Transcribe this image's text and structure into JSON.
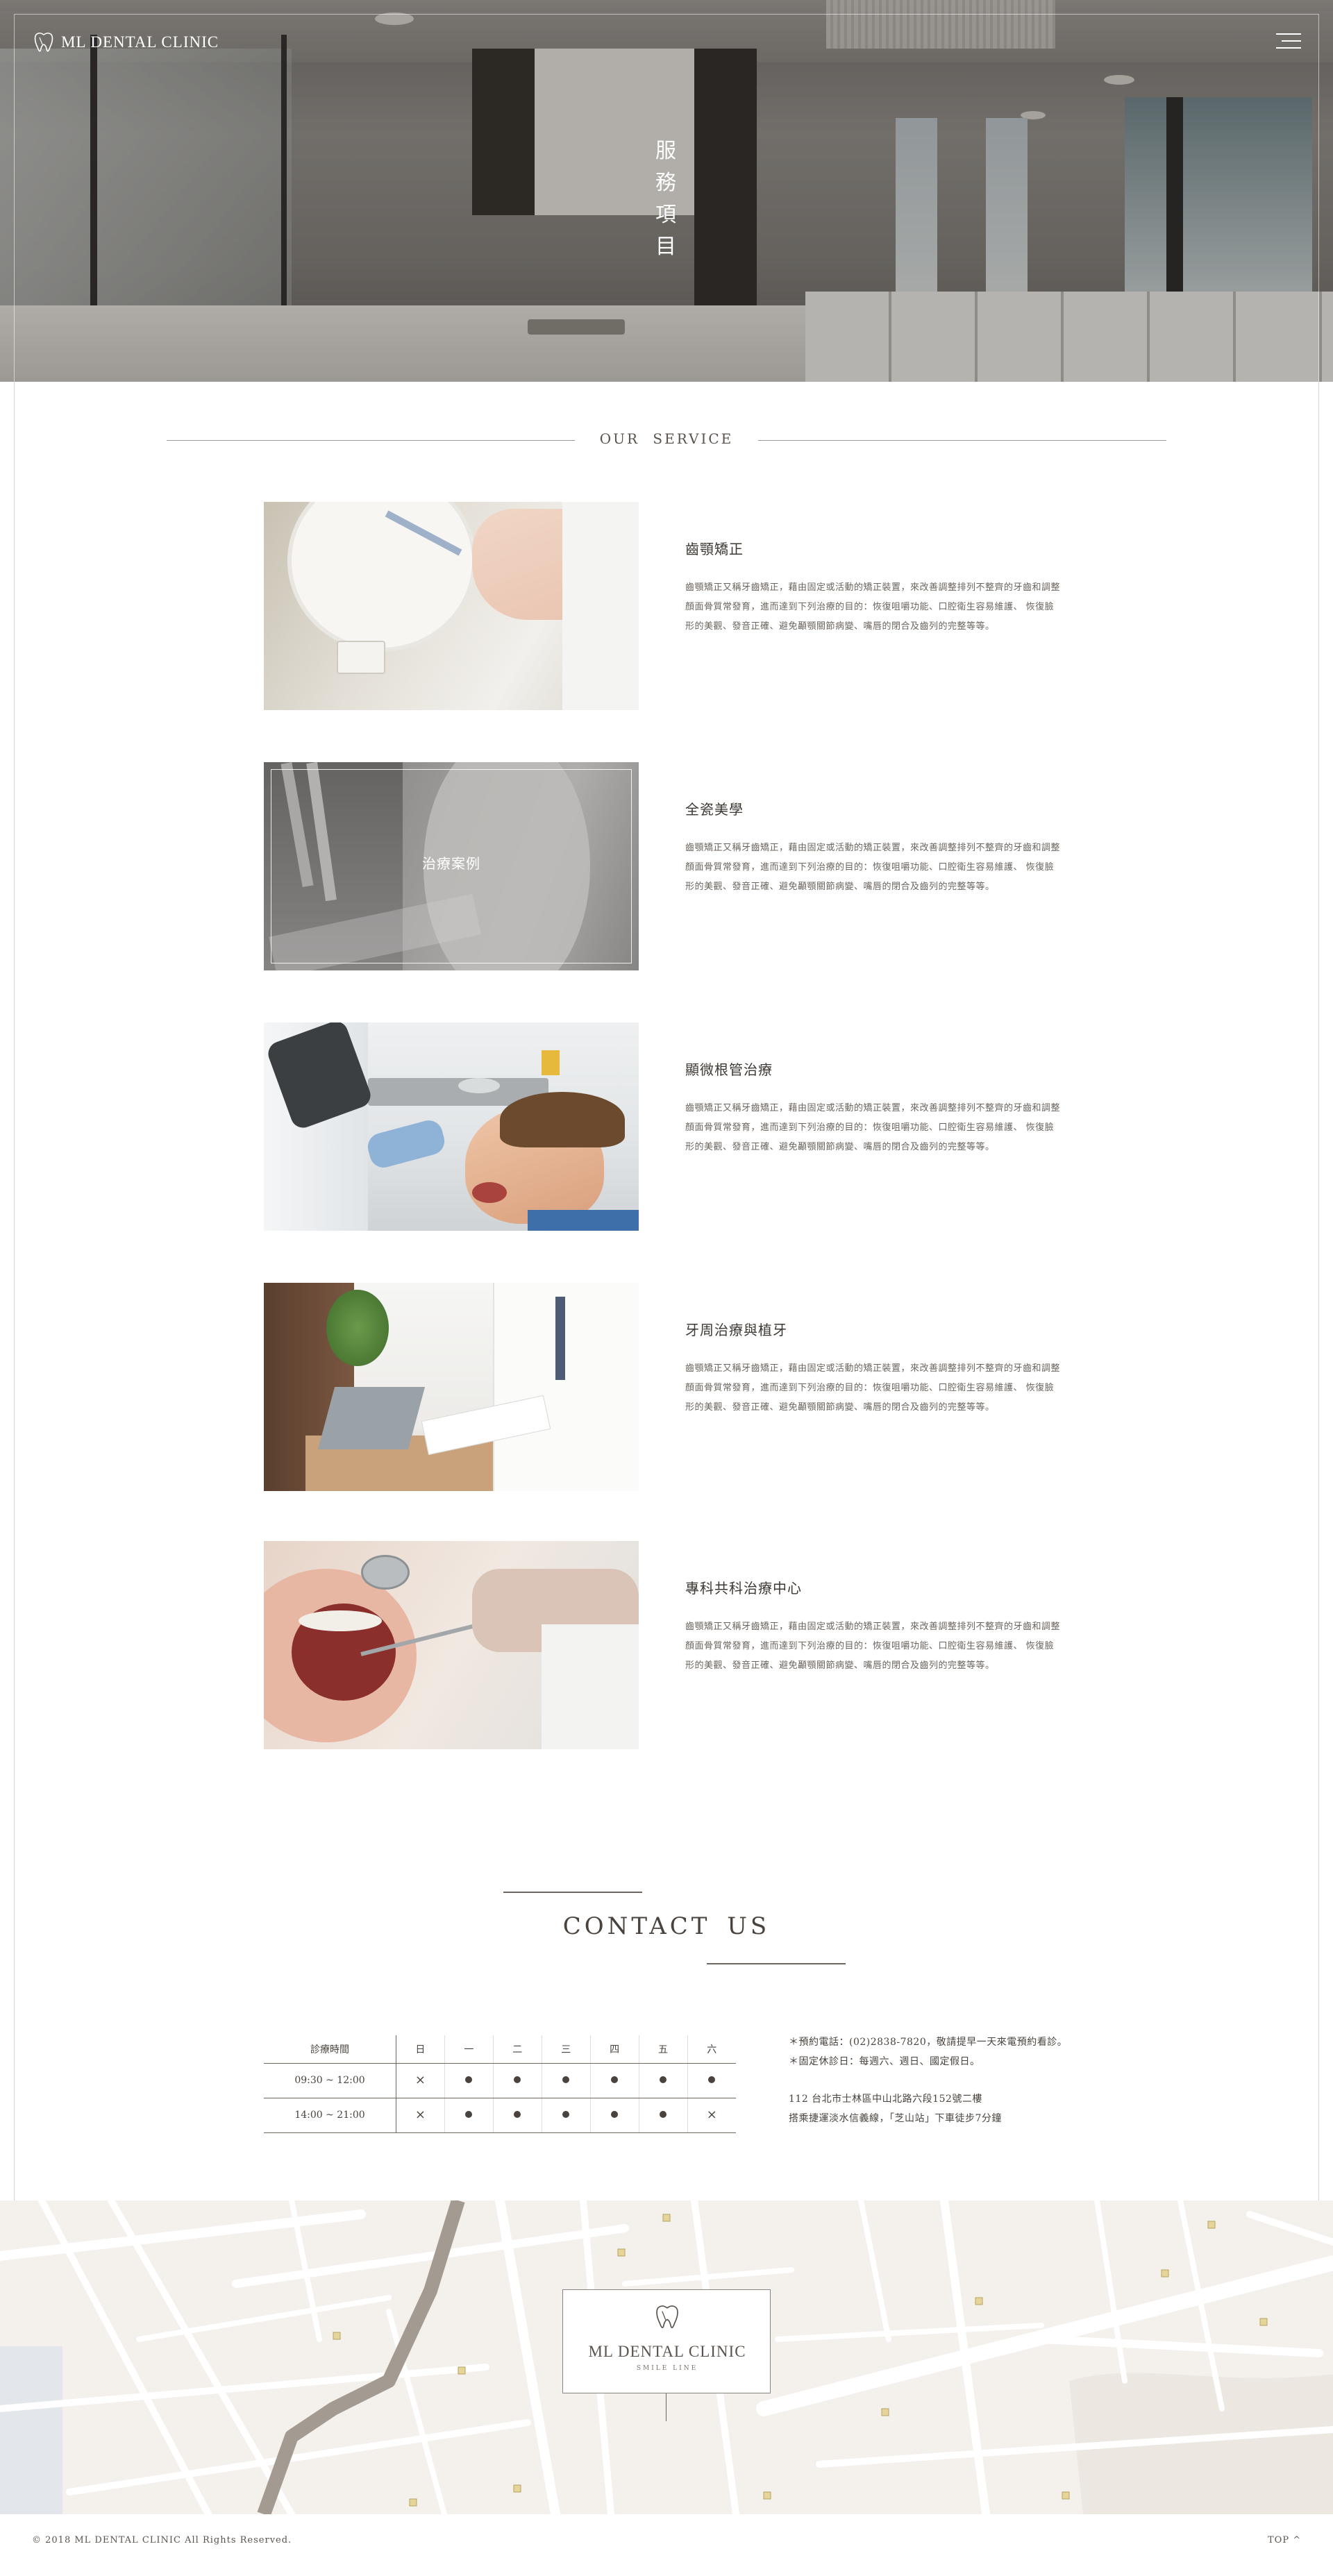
{
  "brand": {
    "name": "ML DENTAL CLINIC",
    "tagline": "SMILE LINE"
  },
  "hero": {
    "title_chars": [
      "服",
      "務",
      "項",
      "目"
    ]
  },
  "service_section": {
    "heading": "OUR SERVICE"
  },
  "services": [
    {
      "title": "齒顎矯正",
      "desc": "齒顎矯正又稱牙齒矯正，藉由固定或活動的矯正裝置，來改善調整排列不整齊的牙齒和調整顏面骨質常發育，進而達到下列治療的目的：恢復咀嚼功能、口腔衛生容易維護、 恢復臉形的美觀、發音正確、避免顳顎關節病變、嘴唇的閉合及齒列的完整等等。"
    },
    {
      "title": "全瓷美學",
      "desc": "齒顎矯正又稱牙齒矯正，藉由固定或活動的矯正裝置，來改善調整排列不整齊的牙齒和調整顏面骨質常發育，進而達到下列治療的目的：恢復咀嚼功能、口腔衛生容易維護、 恢復臉形的美觀、發音正確、避免顳顎關節病變、嘴唇的閉合及齒列的完整等等。",
      "hover_label": "治療案例"
    },
    {
      "title": "顯微根管治療",
      "desc": "齒顎矯正又稱牙齒矯正，藉由固定或活動的矯正裝置，來改善調整排列不整齊的牙齒和調整顏面骨質常發育，進而達到下列治療的目的：恢復咀嚼功能、口腔衛生容易維護、 恢復臉形的美觀、發音正確、避免顳顎關節病變、嘴唇的閉合及齒列的完整等等。"
    },
    {
      "title": "牙周治療與植牙",
      "desc": "齒顎矯正又稱牙齒矯正，藉由固定或活動的矯正裝置，來改善調整排列不整齊的牙齒和調整顏面骨質常發育，進而達到下列治療的目的：恢復咀嚼功能、口腔衛生容易維護、 恢復臉形的美觀、發音正確、避免顳顎關節病變、嘴唇的閉合及齒列的完整等等。"
    },
    {
      "title": "專科共科治療中心",
      "desc": "齒顎矯正又稱牙齒矯正，藉由固定或活動的矯正裝置，來改善調整排列不整齊的牙齒和調整顏面骨質常發育，進而達到下列治療的目的：恢復咀嚼功能、口腔衛生容易維護、 恢復臉形的美觀、發音正確、避免顳顎關節病變、嘴唇的閉合及齒列的完整等等。"
    }
  ],
  "contact": {
    "title": "CONTACT US",
    "hours_table": {
      "header_label": "診療時間",
      "days": [
        "日",
        "一",
        "二",
        "三",
        "四",
        "五",
        "六"
      ],
      "rows": [
        {
          "time": "09:30 ~ 12:00",
          "marks": [
            "×",
            "●",
            "●",
            "●",
            "●",
            "●",
            "●"
          ]
        },
        {
          "time": "14:00 ~ 21:00",
          "marks": [
            "×",
            "●",
            "●",
            "●",
            "●",
            "●",
            "×"
          ]
        }
      ]
    },
    "phone_line": "＊預約電話：(02)2838-7820，敬請提早一天來電預約看診。",
    "holiday_line": "＊固定休診日：每週六、週日、國定假日。",
    "address": "112 台北市士林區中山北路六段152號二樓",
    "transit": "搭乘捷運淡水信義線，「芝山站」下車徒步7分鐘"
  },
  "footer": {
    "copyright": "© 2018 ML DENTAL CLINIC All Rights Reserved.",
    "top_label": "TOP ^"
  }
}
